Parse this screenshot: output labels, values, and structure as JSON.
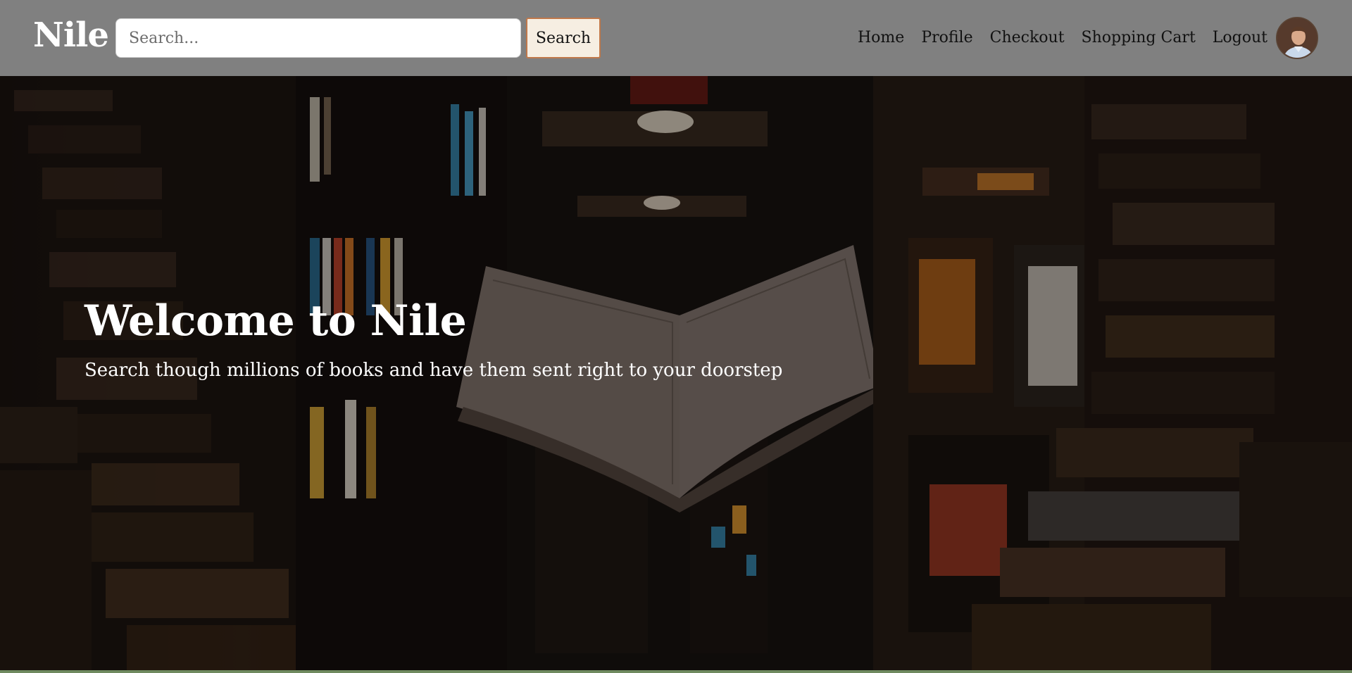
{
  "navbar": {
    "brand": "Nile",
    "search": {
      "placeholder": "Search...",
      "value": "",
      "button_label": "Search"
    },
    "links": [
      {
        "label": "Home"
      },
      {
        "label": "Profile"
      },
      {
        "label": "Checkout"
      },
      {
        "label": "Shopping Cart"
      },
      {
        "label": "Logout"
      }
    ],
    "avatar_icon": "user-avatar-photo"
  },
  "hero": {
    "title": "Welcome to Nile",
    "subtitle": "Search though millions of books and have them sent right to your doorstep",
    "background_image": "open-book-floating-in-library"
  },
  "colors": {
    "navbar_bg": "#808080",
    "search_button_bg": "#f6eee2",
    "search_button_border": "#c0784a",
    "hero_text": "#ffffff",
    "bottom_strip": "#6f8a5f"
  }
}
